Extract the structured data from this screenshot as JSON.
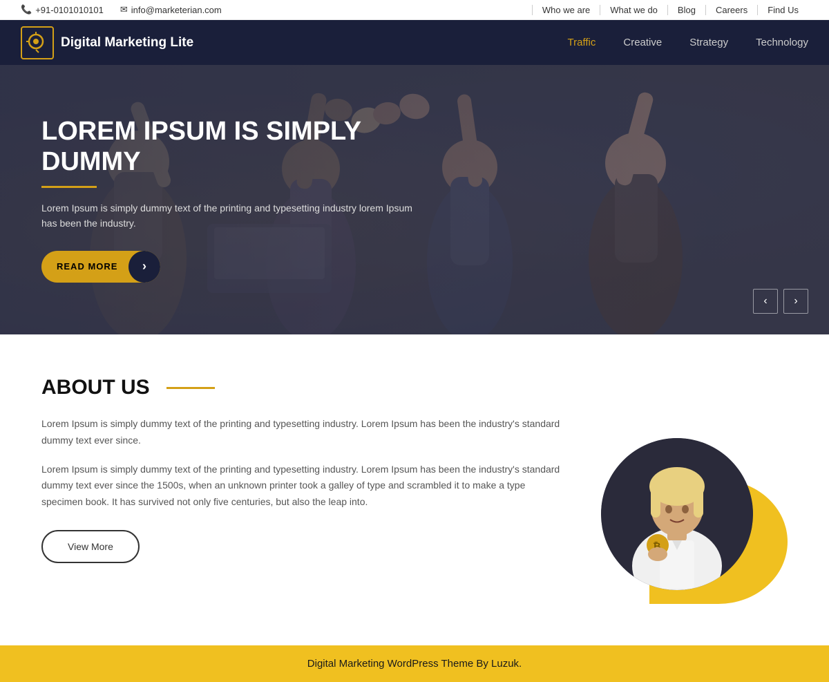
{
  "topbar": {
    "phone_icon": "📞",
    "phone": "+91-0101010101",
    "email_icon": "✉",
    "email": "info@marketerian.com",
    "nav_links": [
      {
        "label": "Who we are",
        "href": "#"
      },
      {
        "label": "What we do",
        "href": "#"
      },
      {
        "label": "Blog",
        "href": "#"
      },
      {
        "label": "Careers",
        "href": "#"
      },
      {
        "label": "Find Us",
        "href": "#"
      }
    ]
  },
  "mainnav": {
    "logo_symbol": "C",
    "logo_text": "Digital Marketing Lite",
    "nav_items": [
      {
        "label": "Traffic",
        "active": true
      },
      {
        "label": "Creative",
        "active": false
      },
      {
        "label": "Strategy",
        "active": false
      },
      {
        "label": "Technology",
        "active": false
      }
    ]
  },
  "hero": {
    "title": "LOREM IPSUM IS SIMPLY DUMMY",
    "subtitle": "Lorem Ipsum is simply dummy text of the printing and typesetting industry lorem Ipsum has been the industry.",
    "cta_label": "READ MORE",
    "prev_arrow": "‹",
    "next_arrow": "›"
  },
  "about": {
    "title": "ABOUT US",
    "para1": "Lorem Ipsum is simply dummy text of the printing and typesetting industry. Lorem Ipsum has been the industry's standard dummy text ever since.",
    "para2": "Lorem Ipsum is simply dummy text of the printing and typesetting industry. Lorem Ipsum has been the industry's standard dummy text ever since the 1500s, when an unknown printer took a galley of type and scrambled it to make a type specimen book. It has survived not only five centuries, but also the leap into.",
    "view_more_label": "View More",
    "coin_symbol": "₿"
  },
  "footer": {
    "text": "Digital Marketing WordPress Theme By Luzuk."
  },
  "colors": {
    "accent": "#d4a017",
    "dark_navy": "#1a1f3a",
    "yellow": "#f0c020"
  }
}
